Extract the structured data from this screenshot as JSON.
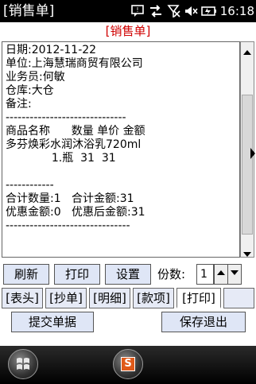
{
  "status_bar": {
    "app_title": "[销售单]",
    "time": "16:18",
    "icons": [
      "chat-icon",
      "sync-arrows-icon",
      "no-signal-icon",
      "mute-speaker-icon",
      "battery-charging-icon"
    ]
  },
  "header": {
    "title": "[销售单]",
    "color": "#d00000"
  },
  "document": {
    "lines": [
      "日期:2012-11-22",
      "单位:上海慧瑞商贸有限公司",
      "业务员:何敏",
      "仓库:大仓",
      "备注:",
      "------------------------------",
      "商品名称      数量 单价 金额",
      "多芬焕彩水润沐浴乳720ml",
      "             1.瓶  31  31",
      "",
      "------------",
      "合计数量:1   合计金额:31",
      "优惠金额:0   优惠后金额:31",
      "-------------------------------"
    ]
  },
  "toolbar": {
    "refresh": "刷新",
    "print": "打印",
    "settings": "设置",
    "copies_label": "份数:",
    "copies_value": "1"
  },
  "tabs": [
    "[表头]",
    "[抄单]",
    "[明细]",
    "[款项]",
    "[打印]"
  ],
  "active_tab": "[打印]",
  "actions": {
    "submit": "提交单据",
    "save_exit": "保存退出"
  },
  "taskbar": {
    "app_badge": "S"
  }
}
